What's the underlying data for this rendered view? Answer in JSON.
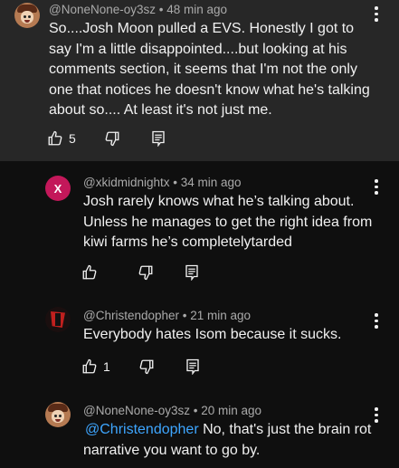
{
  "comments": [
    {
      "author": "@NoneNone-oy3sz",
      "time": "48 min ago",
      "body": "So....Josh Moon pulled a EVS. Honestly I got to say I'm a little disappointed....but looking at his comments section, it seems that I'm not the only one that notices he doesn't know what he's talking about so.... At least it's not just me.",
      "likes": "5",
      "avatar": "cartoon-face-avatar",
      "highlighted": true
    },
    {
      "author": "@xkidmidnightx",
      "time": "34 min ago",
      "body": "Josh rarely knows what he’s talking about. Unless he manages to get the right idea from kiwi farms he’s completelytarded",
      "likes": "",
      "avatar": "letter-x-avatar",
      "avatar_letter": "X"
    },
    {
      "author": "@Christendopher",
      "time": "21 min ago",
      "body": "Everybody hates Isom because it sucks.",
      "likes": "1",
      "avatar": "red-dark-avatar"
    },
    {
      "author": "@NoneNone-oy3sz",
      "time": "20 min ago",
      "mention": "@Christendopher",
      "body": " No, that's just the brain rot narrative you want to go by.",
      "avatar": "cartoon-face-avatar"
    }
  ],
  "colors": {
    "background": "#0f0f0f",
    "highlight": "#272727",
    "mention": "#3ea6ff",
    "meta": "#aaaaaa",
    "avatar_x": "#c3185a"
  },
  "icons": [
    "like-icon",
    "dislike-icon",
    "reply-icon",
    "more-menu-icon"
  ]
}
